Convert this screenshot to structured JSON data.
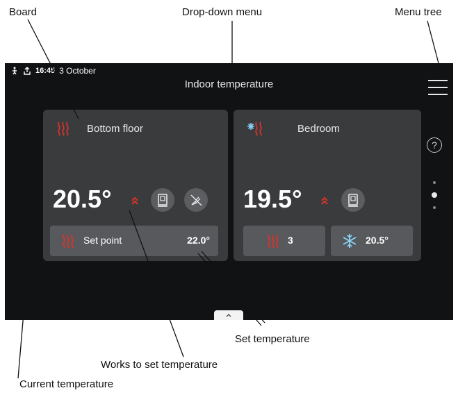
{
  "callouts": {
    "board": "Board",
    "dropdown": "Drop-down menu",
    "menu_tree": "Menu tree",
    "set_temperature": "Set temperature",
    "works_to_set": "Works to set temperature",
    "current_temperature": "Current temperature"
  },
  "status_bar": {
    "time": "16:45",
    "date": "3 October"
  },
  "header": {
    "title": "Indoor temperature"
  },
  "zones": [
    {
      "name": "Bottom floor",
      "temperature": "20.5°",
      "setpoint_label": "Set point",
      "setpoint_value": "22.0°"
    },
    {
      "name": "Bedroom",
      "temperature": "19.5°",
      "heat_value": "3",
      "cool_value": "20.5°"
    }
  ],
  "side": {
    "help_glyph": "?"
  },
  "colors": {
    "heat": "#d9332b",
    "cool": "#8ad2f5",
    "screen": "#111214",
    "card": "#3a3b3d",
    "pill": "#58595c"
  },
  "icons": [
    "person-icon",
    "upload-icon",
    "heating-icon",
    "heating-cooling-icon",
    "thermostat-icon",
    "no-sensor-icon",
    "snowflake-icon",
    "help-icon",
    "menu-icon"
  ]
}
